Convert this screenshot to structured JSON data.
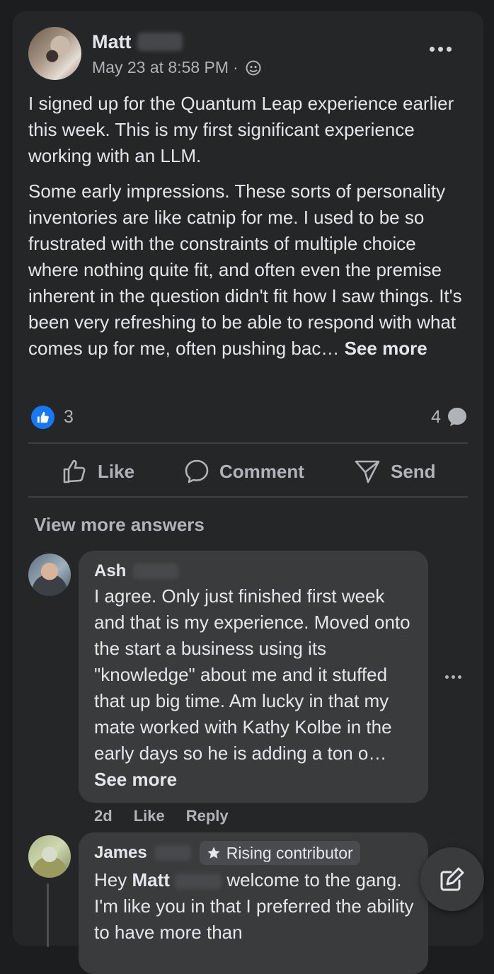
{
  "post": {
    "author": "Matt",
    "timestamp": "May 23 at 8:58 PM",
    "separator": "·",
    "audience_icon": "group-audience-icon",
    "paragraph1": "I signed up for the Quantum Leap experience earlier this week. This is my first significant experience working with an LLM.",
    "paragraph2": "Some early impressions. These sorts of personality inventories are like catnip for me. I used to be so frustrated with the constraints of multiple choice where nothing quite fit, and often even the premise  inherent in the question didn't fit how I saw things. It's been very refreshing to be able to respond with what comes up for me, often pushing bac…",
    "see_more": "See more",
    "reaction_count": "3",
    "comment_count": "4"
  },
  "actions": {
    "like": "Like",
    "comment": "Comment",
    "send": "Send"
  },
  "view_more_answers": "View more answers",
  "comments": [
    {
      "name": "Ash",
      "text": "I agree. Only just finished first week and that is my experience. Moved onto the start a business using its \"knowledge\" about me and it stuffed that up big time. Am lucky in that my mate worked with Kathy Kolbe in the early days so he is adding a ton o…",
      "see_more": "See more",
      "age": "2d",
      "like": "Like",
      "reply": "Reply"
    },
    {
      "name": "James",
      "badge": "Rising contributor",
      "text_prefix": "Hey ",
      "mention": "Matt",
      "text_suffix": " welcome to the gang. I'm like you in that I preferred the ability to have more than"
    }
  ],
  "colors": {
    "background": "#1c1d1f",
    "card": "#252628",
    "bubble": "#3a3b3d",
    "accent": "#1877f2",
    "text_primary": "#e4e6eb",
    "text_secondary": "#b0b3b8"
  }
}
